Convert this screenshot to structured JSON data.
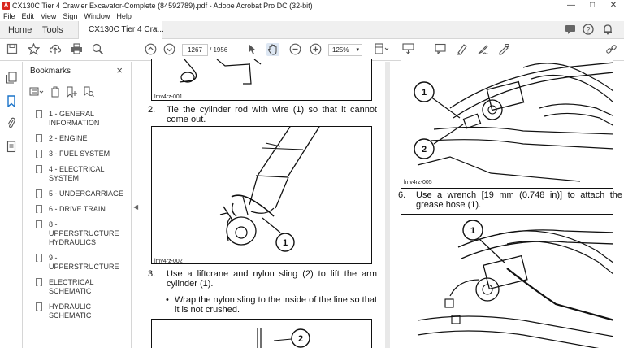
{
  "window": {
    "title": "CX130C Tier 4 Crawler Excavator-Complete (84592789).pdf - Adobe Acrobat Pro DC (32-bit)",
    "app_icon_letter": "A",
    "controls": [
      "—",
      "□",
      "✕"
    ]
  },
  "menu": [
    "File",
    "Edit",
    "View",
    "Sign",
    "Window",
    "Help"
  ],
  "tabs": {
    "home": "Home",
    "tools": "Tools",
    "document": "CX130C Tier 4 Cra...",
    "close_symbol": "×"
  },
  "toolbar": {
    "current_page": "1267",
    "total_pages": "/ 1956",
    "zoom": "125%",
    "zoom_dropdown": "▾"
  },
  "bookmarks": {
    "header": "Bookmarks",
    "close_symbol": "×",
    "items": [
      {
        "label": "1 - GENERAL INFORMATION"
      },
      {
        "label": "2 - ENGINE"
      },
      {
        "label": "3 - FUEL SYSTEM"
      },
      {
        "label": "4 - ELECTRICAL SYSTEM"
      },
      {
        "label": "5 - UNDERCARRIAGE"
      },
      {
        "label": "6 - DRIVE TRAIN"
      },
      {
        "label": "8 - UPPERSTRUCTURE HYDRAULICS"
      },
      {
        "label": "9 - UPPERSTRUCTURE"
      },
      {
        "label": "ELECTRICAL SCHEMATIC"
      },
      {
        "label": "HYDRAULIC SCHEMATIC"
      }
    ]
  },
  "document": {
    "left_page": {
      "fig1_label": "lmv4rz-001",
      "step2_num": "2.",
      "step2_text": "Tie the cylinder rod with wire (1) so that it cannot come out.",
      "fig2_label": "lmv4rz-002",
      "fig2_callout": "1",
      "step3_num": "3.",
      "step3_text": "Use a liftcrane and nylon sling (2) to lift the arm cylinder (1).",
      "bullet": "•",
      "step3_sub": "Wrap the nylon sling to the inside of the line so that it is not crushed.",
      "fig3_callout": "2"
    },
    "right_page": {
      "fig_top_label": "lmv4rz-005",
      "fig_top_callout1": "1",
      "fig_top_callout2": "2",
      "step6_num": "6.",
      "step6_text": "Use a wrench [19 mm (0.748 in)] to attach the grease hose (1).",
      "fig_bottom_callout": "1"
    }
  }
}
